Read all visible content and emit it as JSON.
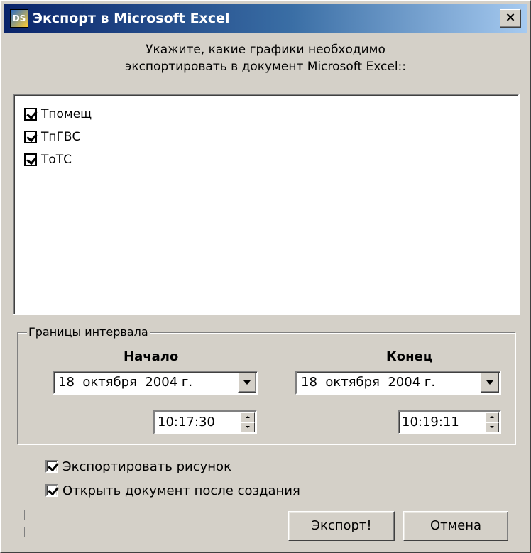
{
  "window": {
    "title": "Экспорт в Microsoft Excel",
    "icon": "app-icon",
    "icon_text": "DS",
    "close_label": "×"
  },
  "prompt": {
    "line1": "Укажите, какие графики необходимо",
    "line2": "экспортировать в документ Microsoft Excel::"
  },
  "graphs": [
    {
      "label": "Тпомещ",
      "checked": true
    },
    {
      "label": "ТпГВС",
      "checked": true
    },
    {
      "label": "ТоТС",
      "checked": true
    }
  ],
  "interval": {
    "legend": "Границы интервала",
    "start": {
      "heading": "Начало",
      "date": "18  октября  2004 г.",
      "time": "10:17:30"
    },
    "end": {
      "heading": "Конец",
      "date": "18  октября  2004 г.",
      "time": "10:19:11"
    }
  },
  "options": {
    "export_picture": {
      "label": "Экспортировать рисунок",
      "checked": true
    },
    "open_document": {
      "label": "Открыть документ после создания",
      "checked": true
    }
  },
  "progress": {
    "bar1": 0,
    "bar2": 0
  },
  "buttons": {
    "export": "Экспорт!",
    "cancel": "Отмена"
  }
}
